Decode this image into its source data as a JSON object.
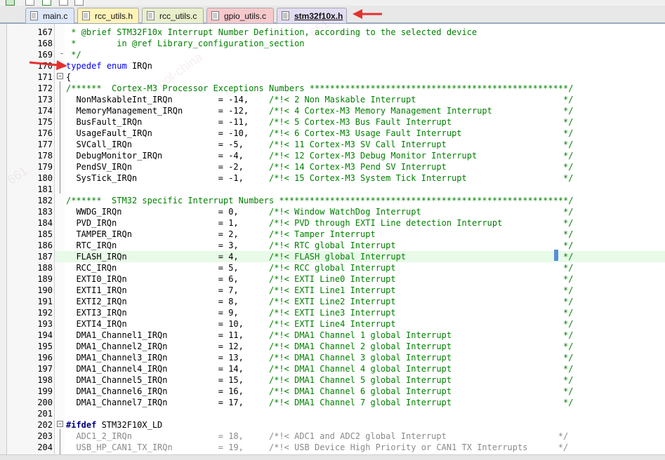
{
  "tabs": [
    {
      "label": "main.c",
      "color": "#dfe8f8"
    },
    {
      "label": "rcc_utils.h",
      "color": "#fff3b8"
    },
    {
      "label": "rcc_utils.c",
      "color": "#e9efcd"
    },
    {
      "label": "gpio_utils.c",
      "color": "#f6c9cc"
    },
    {
      "label": "stm32f10x.h",
      "color": "#e2dcf3",
      "active": true
    }
  ],
  "lines": [
    {
      "n": "167",
      "segs": [
        {
          "c": "cmt",
          "t": " * @brief STM32F10x Interrupt Number Definition, according to the selected device"
        }
      ]
    },
    {
      "n": "168",
      "segs": [
        {
          "c": "cmt",
          "t": " *        in @ref Library_configuration_section"
        }
      ]
    },
    {
      "n": "169",
      "segs": [
        {
          "c": "cmt",
          "t": " */"
        }
      ]
    },
    {
      "n": "170",
      "segs": [
        {
          "c": "kw",
          "t": "typedef"
        },
        {
          "c": "",
          "t": " "
        },
        {
          "c": "kw",
          "t": "enum"
        },
        {
          "c": "",
          "t": " IRQn"
        }
      ]
    },
    {
      "n": "171",
      "segs": [
        {
          "c": "",
          "t": "{"
        }
      ]
    },
    {
      "n": "172",
      "segs": [
        {
          "c": "cmt",
          "t": "/******  Cortex-M3 Processor Exceptions Numbers ***************************************************/"
        }
      ]
    },
    {
      "n": "173",
      "segs": [
        {
          "c": "",
          "t": "  NonMaskableInt_IRQn         = -14,    "
        },
        {
          "c": "cmt",
          "t": "/*!< 2 Non Maskable Interrupt                             */"
        }
      ]
    },
    {
      "n": "174",
      "segs": [
        {
          "c": "",
          "t": "  MemoryManagement_IRQn       = -12,    "
        },
        {
          "c": "cmt",
          "t": "/*!< 4 Cortex-M3 Memory Management Interrupt              */"
        }
      ]
    },
    {
      "n": "175",
      "segs": [
        {
          "c": "",
          "t": "  BusFault_IRQn               = -11,    "
        },
        {
          "c": "cmt",
          "t": "/*!< 5 Cortex-M3 Bus Fault Interrupt                      */"
        }
      ]
    },
    {
      "n": "176",
      "segs": [
        {
          "c": "",
          "t": "  UsageFault_IRQn             = -10,    "
        },
        {
          "c": "cmt",
          "t": "/*!< 6 Cortex-M3 Usage Fault Interrupt                    */"
        }
      ]
    },
    {
      "n": "177",
      "segs": [
        {
          "c": "",
          "t": "  SVCall_IRQn                 = -5,     "
        },
        {
          "c": "cmt",
          "t": "/*!< 11 Cortex-M3 SV Call Interrupt                       */"
        }
      ]
    },
    {
      "n": "178",
      "segs": [
        {
          "c": "",
          "t": "  DebugMonitor_IRQn           = -4,     "
        },
        {
          "c": "cmt",
          "t": "/*!< 12 Cortex-M3 Debug Monitor Interrupt                 */"
        }
      ]
    },
    {
      "n": "179",
      "segs": [
        {
          "c": "",
          "t": "  PendSV_IRQn                 = -2,     "
        },
        {
          "c": "cmt",
          "t": "/*!< 14 Cortex-M3 Pend SV Interrupt                       */"
        }
      ]
    },
    {
      "n": "180",
      "segs": [
        {
          "c": "",
          "t": "  SysTick_IRQn                = -1,     "
        },
        {
          "c": "cmt",
          "t": "/*!< 15 Cortex-M3 System Tick Interrupt                   */"
        }
      ]
    },
    {
      "n": "181",
      "segs": [
        {
          "c": "",
          "t": ""
        }
      ]
    },
    {
      "n": "182",
      "segs": [
        {
          "c": "cmt",
          "t": "/******  STM32 specific Interrupt Numbers *********************************************************/"
        }
      ]
    },
    {
      "n": "183",
      "segs": [
        {
          "c": "",
          "t": "  WWDG_IRQn                   = 0,      "
        },
        {
          "c": "cmt",
          "t": "/*!< Window WatchDog Interrupt                            */"
        }
      ]
    },
    {
      "n": "184",
      "segs": [
        {
          "c": "",
          "t": "  PVD_IRQn                    = 1,      "
        },
        {
          "c": "cmt",
          "t": "/*!< PVD through EXTI Line detection Interrupt            */"
        }
      ]
    },
    {
      "n": "185",
      "segs": [
        {
          "c": "",
          "t": "  TAMPER_IRQn                 = 2,      "
        },
        {
          "c": "cmt",
          "t": "/*!< Tamper Interrupt                                     */"
        }
      ]
    },
    {
      "n": "186",
      "segs": [
        {
          "c": "",
          "t": "  RTC_IRQn                    = 3,      "
        },
        {
          "c": "cmt",
          "t": "/*!< RTC global Interrupt                                 */"
        }
      ]
    },
    {
      "n": "187",
      "hl": true,
      "segs": [
        {
          "c": "",
          "t": "  FLASH_IRQn                  = 4,      "
        },
        {
          "c": "cmt",
          "t": "/*!< FLASH global Interrupt                               */"
        }
      ]
    },
    {
      "n": "188",
      "segs": [
        {
          "c": "",
          "t": "  RCC_IRQn                    = 5,      "
        },
        {
          "c": "cmt",
          "t": "/*!< RCC global Interrupt                                 */"
        }
      ]
    },
    {
      "n": "189",
      "segs": [
        {
          "c": "",
          "t": "  EXTI0_IRQn                  = 6,      "
        },
        {
          "c": "cmt",
          "t": "/*!< EXTI Line0 Interrupt                                 */"
        }
      ]
    },
    {
      "n": "190",
      "segs": [
        {
          "c": "",
          "t": "  EXTI1_IRQn                  = 7,      "
        },
        {
          "c": "cmt",
          "t": "/*!< EXTI Line1 Interrupt                                 */"
        }
      ]
    },
    {
      "n": "191",
      "segs": [
        {
          "c": "",
          "t": "  EXTI2_IRQn                  = 8,      "
        },
        {
          "c": "cmt",
          "t": "/*!< EXTI Line2 Interrupt                                 */"
        }
      ]
    },
    {
      "n": "192",
      "segs": [
        {
          "c": "",
          "t": "  EXTI3_IRQn                  = 9,      "
        },
        {
          "c": "cmt",
          "t": "/*!< EXTI Line3 Interrupt                                 */"
        }
      ]
    },
    {
      "n": "193",
      "segs": [
        {
          "c": "",
          "t": "  EXTI4_IRQn                  = 10,     "
        },
        {
          "c": "cmt",
          "t": "/*!< EXTI Line4 Interrupt                                 */"
        }
      ]
    },
    {
      "n": "194",
      "segs": [
        {
          "c": "",
          "t": "  DMA1_Channel1_IRQn          = 11,     "
        },
        {
          "c": "cmt",
          "t": "/*!< DMA1 Channel 1 global Interrupt                      */"
        }
      ]
    },
    {
      "n": "195",
      "segs": [
        {
          "c": "",
          "t": "  DMA1_Channel2_IRQn          = 12,     "
        },
        {
          "c": "cmt",
          "t": "/*!< DMA1 Channel 2 global Interrupt                      */"
        }
      ]
    },
    {
      "n": "196",
      "segs": [
        {
          "c": "",
          "t": "  DMA1_Channel3_IRQn          = 13,     "
        },
        {
          "c": "cmt",
          "t": "/*!< DMA1 Channel 3 global Interrupt                      */"
        }
      ]
    },
    {
      "n": "197",
      "segs": [
        {
          "c": "",
          "t": "  DMA1_Channel4_IRQn          = 14,     "
        },
        {
          "c": "cmt",
          "t": "/*!< DMA1 Channel 4 global Interrupt                      */"
        }
      ]
    },
    {
      "n": "198",
      "segs": [
        {
          "c": "",
          "t": "  DMA1_Channel5_IRQn          = 15,     "
        },
        {
          "c": "cmt",
          "t": "/*!< DMA1 Channel 5 global Interrupt                      */"
        }
      ]
    },
    {
      "n": "199",
      "segs": [
        {
          "c": "",
          "t": "  DMA1_Channel6_IRQn          = 16,     "
        },
        {
          "c": "cmt",
          "t": "/*!< DMA1 Channel 6 global Interrupt                      */"
        }
      ]
    },
    {
      "n": "200",
      "segs": [
        {
          "c": "",
          "t": "  DMA1_Channel7_IRQn          = 17,     "
        },
        {
          "c": "cmt",
          "t": "/*!< DMA1 Channel 7 global Interrupt                      */"
        }
      ]
    },
    {
      "n": "201",
      "segs": [
        {
          "c": "",
          "t": ""
        }
      ]
    },
    {
      "n": "202",
      "segs": [
        {
          "c": "pp",
          "t": "#ifdef"
        },
        {
          "c": "",
          "t": " STM32F10X_LD"
        }
      ]
    },
    {
      "n": "203",
      "segs": [
        {
          "c": "gray",
          "t": "  ADC1_2_IRQn                 = 18,     /*!< ADC1 and ADC2 global Interrupt                      */"
        }
      ]
    },
    {
      "n": "204",
      "segs": [
        {
          "c": "gray",
          "t": "  USB_HP_CAN1_TX_IRQn         = 19,     /*!< USB Device High Priority or CAN1 TX Interrupts      */"
        }
      ]
    }
  ]
}
